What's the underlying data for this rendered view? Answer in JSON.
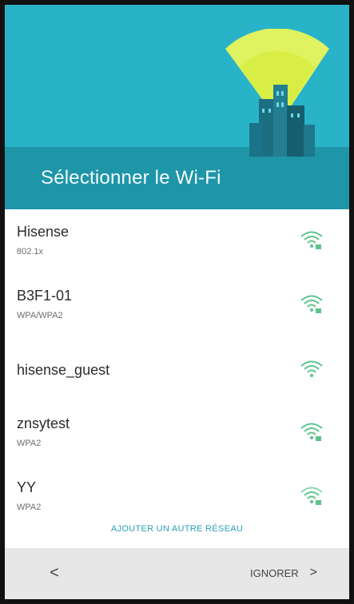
{
  "header": {
    "title": "Sélectionner le Wi-Fi",
    "illustration_icon": "city-wifi-illustration",
    "colors": {
      "header": "#29b3c8",
      "shade": "#1f95a8",
      "signal_beam": "#e9f55a"
    }
  },
  "networks": [
    {
      "ssid": "Hisense",
      "security": "802.1x",
      "icon": "wifi-locked-icon"
    },
    {
      "ssid": "B3F1-01",
      "security": "WPA/WPA2",
      "icon": "wifi-locked-icon"
    },
    {
      "ssid": "hisense_guest",
      "security": "",
      "icon": "wifi-icon"
    },
    {
      "ssid": "znsytest",
      "security": "WPA2",
      "icon": "wifi-locked-icon"
    },
    {
      "ssid": "YY",
      "security": "WPA2",
      "icon": "wifi-locked-icon"
    }
  ],
  "actions": {
    "add_network": "AJOUTER UN AUTRE RÉSEAU",
    "back": "<",
    "skip": "IGNORER",
    "skip_chevron": ">"
  },
  "colors": {
    "wifi_icon": "#5cc48a",
    "link": "#2aa0bd",
    "bottom_bar": "#e7e7e7"
  }
}
